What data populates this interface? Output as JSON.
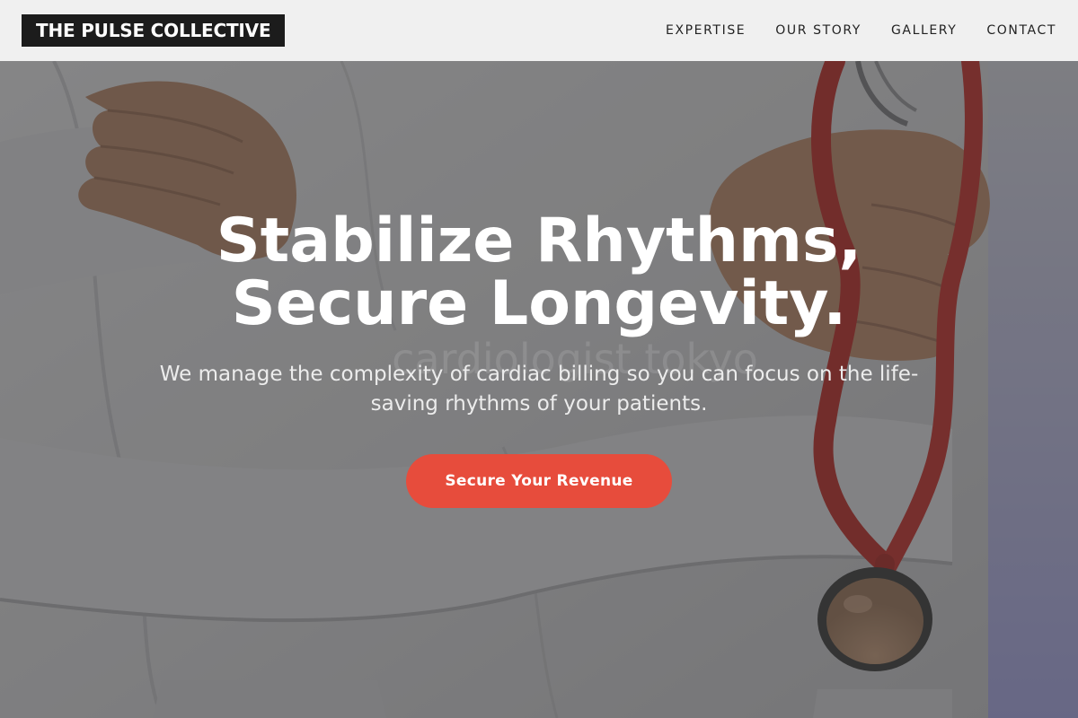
{
  "brand": {
    "name": "THE PULSE COLLECTIVE"
  },
  "nav": {
    "items": [
      {
        "label": "EXPERTISE"
      },
      {
        "label": "OUR STORY"
      },
      {
        "label": "GALLERY"
      },
      {
        "label": "CONTACT"
      }
    ]
  },
  "hero": {
    "title_line1": "Stabilize Rhythms,",
    "title_line2": "Secure Longevity.",
    "subtitle": "We manage the complexity of cardiac billing so you can focus on the life-saving rhythms of your patients.",
    "cta_label": "Secure Your Revenue",
    "watermark": "cardiologist tokyo",
    "image_subject": "doctor-in-white-coat-with-red-stethoscope"
  },
  "colors": {
    "nav_bg": "#f0f0f0",
    "logo_bg": "#1c1c1c",
    "accent": "#e74c3c",
    "hero_overlay": "#3a3a3a"
  }
}
